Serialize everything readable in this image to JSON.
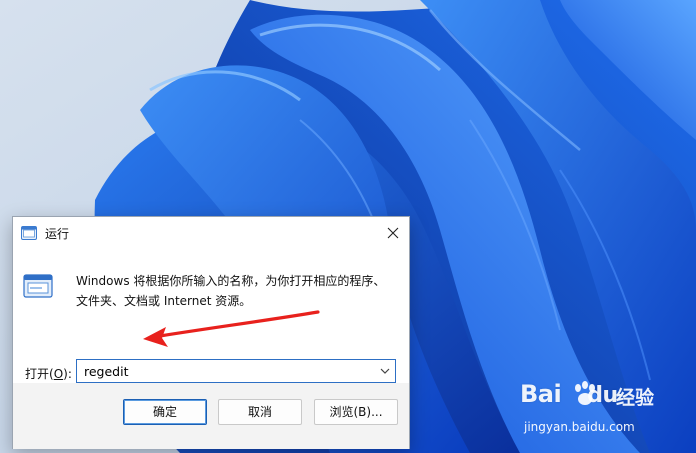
{
  "run_dialog": {
    "title": "运行",
    "description_line1": "Windows 将根据你所输入的名称，为你打开相应的程序、",
    "description_line2": "文件夹、文档或 Internet 资源。",
    "open_label_prefix": "打开(",
    "open_label_accel": "O",
    "open_label_suffix": "):",
    "open_value": "regedit",
    "ok_label": "确定",
    "cancel_label": "取消",
    "browse_label": "浏览(B)..."
  },
  "watermark": {
    "brand_left": "Bai",
    "brand_right": "du",
    "product": "经验",
    "url": "jingyan.baidu.com"
  },
  "colors": {
    "accent": "#1b5fb3",
    "arrow": "#e8211d",
    "wallpaper_blue": "#1565e0"
  },
  "icons": {
    "title": "run-icon",
    "close": "close-icon",
    "dropdown": "chevron-down-icon"
  }
}
